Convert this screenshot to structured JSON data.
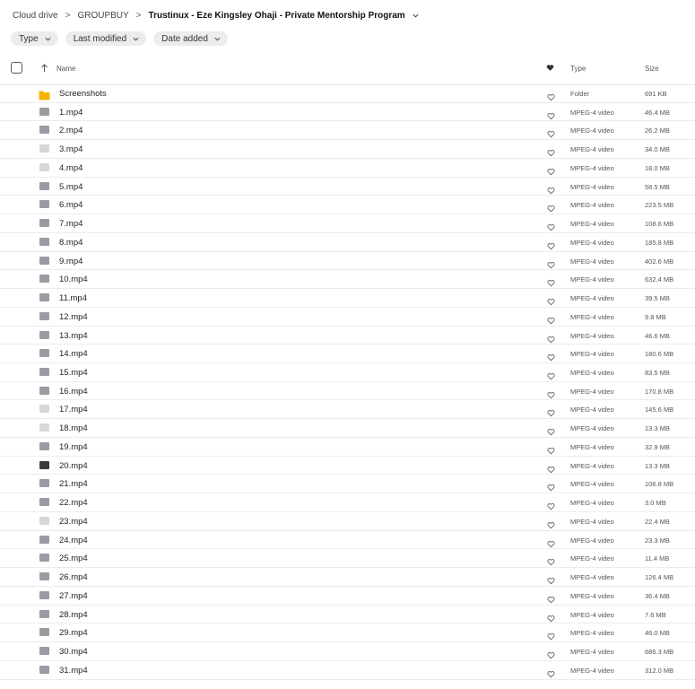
{
  "breadcrumb": {
    "items": [
      "Cloud drive",
      "GROUPBUY"
    ],
    "current": "Trustinux - Eze Kingsley Ohaji - Private Mentorship Program",
    "separator": ">"
  },
  "filters": [
    {
      "label": "Type"
    },
    {
      "label": "Last modified"
    },
    {
      "label": "Date added"
    }
  ],
  "table": {
    "columns": {
      "name": "Name",
      "type": "Type",
      "size": "Size"
    },
    "rows": [
      {
        "name": "Screenshots",
        "type": "Folder",
        "size": "691 KB",
        "icon": "folder"
      },
      {
        "name": "1.mp4",
        "type": "MPEG-4 video",
        "size": "46.4 MB",
        "icon": "video"
      },
      {
        "name": "2.mp4",
        "type": "MPEG-4 video",
        "size": "26.2 MB",
        "icon": "video"
      },
      {
        "name": "3.mp4",
        "type": "MPEG-4 video",
        "size": "34.0 MB",
        "icon": "video-light"
      },
      {
        "name": "4.mp4",
        "type": "MPEG-4 video",
        "size": "18.0 MB",
        "icon": "video-light"
      },
      {
        "name": "5.mp4",
        "type": "MPEG-4 video",
        "size": "58.5 MB",
        "icon": "video"
      },
      {
        "name": "6.mp4",
        "type": "MPEG-4 video",
        "size": "223.5 MB",
        "icon": "video"
      },
      {
        "name": "7.mp4",
        "type": "MPEG-4 video",
        "size": "108.6 MB",
        "icon": "video"
      },
      {
        "name": "8.mp4",
        "type": "MPEG-4 video",
        "size": "185.8 MB",
        "icon": "video"
      },
      {
        "name": "9.mp4",
        "type": "MPEG-4 video",
        "size": "402.6 MB",
        "icon": "video"
      },
      {
        "name": "10.mp4",
        "type": "MPEG-4 video",
        "size": "632.4 MB",
        "icon": "video"
      },
      {
        "name": "11.mp4",
        "type": "MPEG-4 video",
        "size": "39.5 MB",
        "icon": "video"
      },
      {
        "name": "12.mp4",
        "type": "MPEG-4 video",
        "size": "9.8 MB",
        "icon": "video"
      },
      {
        "name": "13.mp4",
        "type": "MPEG-4 video",
        "size": "46.6 MB",
        "icon": "video"
      },
      {
        "name": "14.mp4",
        "type": "MPEG-4 video",
        "size": "180.6 MB",
        "icon": "video"
      },
      {
        "name": "15.mp4",
        "type": "MPEG-4 video",
        "size": "83.5 MB",
        "icon": "video"
      },
      {
        "name": "16.mp4",
        "type": "MPEG-4 video",
        "size": "170.8 MB",
        "icon": "video"
      },
      {
        "name": "17.mp4",
        "type": "MPEG-4 video",
        "size": "145.6 MB",
        "icon": "video-light"
      },
      {
        "name": "18.mp4",
        "type": "MPEG-4 video",
        "size": "13.3 MB",
        "icon": "video-light"
      },
      {
        "name": "19.mp4",
        "type": "MPEG-4 video",
        "size": "32.9 MB",
        "icon": "video"
      },
      {
        "name": "20.mp4",
        "type": "MPEG-4 video",
        "size": "13.3 MB",
        "icon": "video-dark"
      },
      {
        "name": "21.mp4",
        "type": "MPEG-4 video",
        "size": "106.8 MB",
        "icon": "video"
      },
      {
        "name": "22.mp4",
        "type": "MPEG-4 video",
        "size": "3.0 MB",
        "icon": "video"
      },
      {
        "name": "23.mp4",
        "type": "MPEG-4 video",
        "size": "22.4 MB",
        "icon": "video-light"
      },
      {
        "name": "24.mp4",
        "type": "MPEG-4 video",
        "size": "23.3 MB",
        "icon": "video"
      },
      {
        "name": "25.mp4",
        "type": "MPEG-4 video",
        "size": "11.4 MB",
        "icon": "video"
      },
      {
        "name": "26.mp4",
        "type": "MPEG-4 video",
        "size": "126.4 MB",
        "icon": "video"
      },
      {
        "name": "27.mp4",
        "type": "MPEG-4 video",
        "size": "36.4 MB",
        "icon": "video"
      },
      {
        "name": "28.mp4",
        "type": "MPEG-4 video",
        "size": "7.6 MB",
        "icon": "video"
      },
      {
        "name": "29.mp4",
        "type": "MPEG-4 video",
        "size": "46.0 MB",
        "icon": "video"
      },
      {
        "name": "30.mp4",
        "type": "MPEG-4 video",
        "size": "686.3 MB",
        "icon": "video"
      },
      {
        "name": "31.mp4",
        "type": "MPEG-4 video",
        "size": "312.0 MB",
        "icon": "video"
      }
    ]
  }
}
